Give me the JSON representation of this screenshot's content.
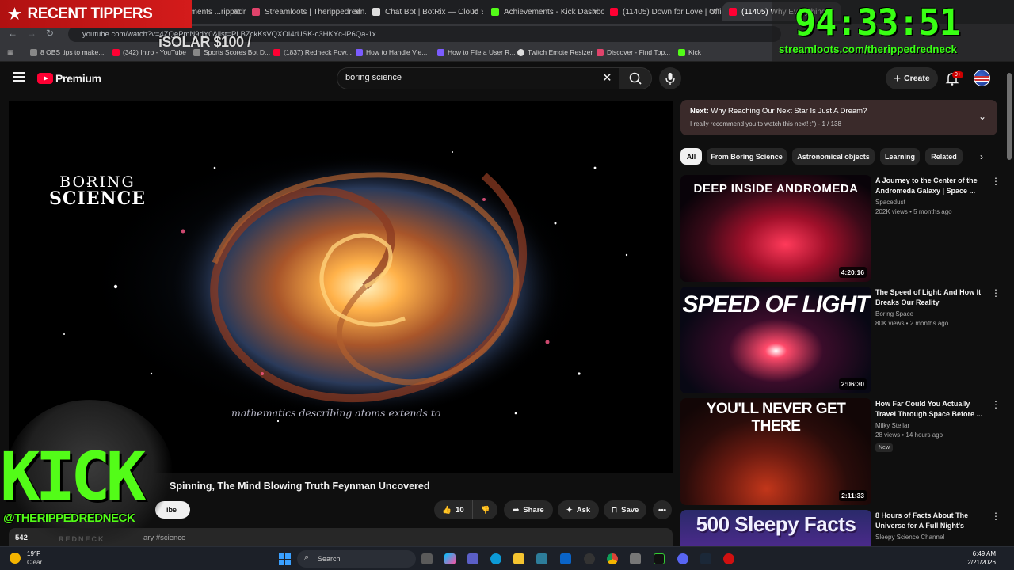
{
  "browser": {
    "tabs": [
      {
        "label": "StreamElements ...rippedredn",
        "color": "#e44"
      },
      {
        "label": "Streamloots | Therippedredn...",
        "color": "#e0436b"
      },
      {
        "label": "Chat Bot | BotRix — Cloud St...",
        "color": "#ddd"
      },
      {
        "label": "Achievements - Kick Dashbo...",
        "color": "#53fc18"
      },
      {
        "label": "(11405) Down for Love | Offic...",
        "color": "#ff0033"
      },
      {
        "label": "(11405) Why Everything...",
        "color": "#ff0033"
      }
    ],
    "url": "youtube.com/watch?v=4ZQePmN9dY0&list=PLBZckKsVQXOI4rUSK-c3HKYc-iP6Qa-1x",
    "bookmarks": [
      {
        "label": "8 OBS tips to make...",
        "color": "#888"
      },
      {
        "label": "(342) Intro - YouTube",
        "color": "#ff0033"
      },
      {
        "label": "Sports Scores Bot D...",
        "color": "#888"
      },
      {
        "label": "(1837) Redneck Pow...",
        "color": "#ff0033"
      },
      {
        "label": "How to Handle Vie...",
        "color": "#7b5cff"
      },
      {
        "label": "How to File a User R...",
        "color": "#7b5cff"
      },
      {
        "label": "Twitch Emote Resizer",
        "color": "#ddd"
      },
      {
        "label": "Discover - Find Top...",
        "color": "#e0436b"
      },
      {
        "label": "Kick",
        "color": "#53fc18"
      }
    ]
  },
  "header": {
    "logo_text": "Premium",
    "search_value": "boring science",
    "create_label": "Create",
    "notification_count": "9+"
  },
  "player": {
    "brand_line1": "BORING",
    "brand_line2": "SCIENCE",
    "caption": "mathematics describing atoms extends to"
  },
  "video": {
    "title": "Spinning, The Mind Blowing Truth Feynman Uncovered",
    "subscribe_label": "ibe",
    "likes": "10",
    "share_label": "Share",
    "ask_label": "Ask",
    "save_label": "Save",
    "views": "542",
    "hashtags": "ary #science"
  },
  "playlist": {
    "next_prefix": "Next:",
    "next_title": "Why Reaching Our Next Star Is Just A Dream?",
    "subtitle": "I really recommend you to watch this next! :\") - 1 / 138"
  },
  "chips": [
    "All",
    "From Boring Science",
    "Astronomical objects",
    "Learning",
    "Related"
  ],
  "recommendations": [
    {
      "thumb_text": "DEEP INSIDE ANDROMEDA",
      "duration": "4:20:16",
      "title": "A Journey to the Center of the Andromeda Galaxy | Space ...",
      "channel": "Spacedust",
      "meta": "202K views • 5 months ago"
    },
    {
      "thumb_text": "SPEED OF LIGHT",
      "duration": "2:06:30",
      "title": "The Speed of Light: And How It Breaks Our Reality",
      "channel": "Boring Space",
      "meta": "80K views • 2 months ago"
    },
    {
      "thumb_text": "YOU'LL NEVER GET THERE",
      "duration": "2:11:33",
      "title": "How Far Could You Actually Travel Through Space Before ...",
      "channel": "Milky Stellar",
      "meta": "28 views • 14 hours ago",
      "badge": "New"
    },
    {
      "thumb_text": "500 Sleepy Facts",
      "duration": "",
      "title": "8 Hours of Facts About The Universe for A Full Night's Slee...",
      "channel": "Sleepy Science Channel",
      "meta": ""
    }
  ],
  "overlay": {
    "recent_tippers": "RECENT TIPPERS",
    "tipper_item": "iSOLAR $100 /",
    "timer": "94:33:51",
    "streamloots": "streamloots.com/therippedredneck",
    "kick": "KICK",
    "kick_handle": "@THERIPPEDREDNECK",
    "redneck": "REDNECK"
  },
  "taskbar": {
    "temp": "19°F",
    "condition": "Clear",
    "search_placeholder": "Search",
    "time": "6:49 AM",
    "date": "2/21/2026"
  }
}
